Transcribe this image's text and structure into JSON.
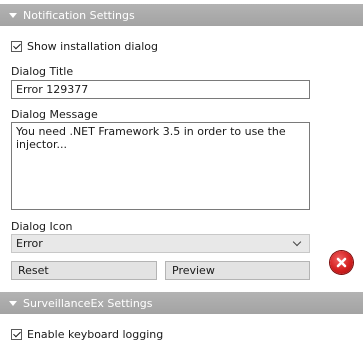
{
  "notification": {
    "header": "Notification Settings",
    "show_dialog_label": "Show installation dialog",
    "dialog_title_label": "Dialog Title",
    "dialog_title_value": "Error 129377",
    "dialog_message_label": "Dialog Message",
    "dialog_message_value": "You need .NET Framework 3.5 in order to use the injector...",
    "dialog_icon_label": "Dialog Icon",
    "dialog_icon_selected": "Error",
    "reset_label": "Reset",
    "preview_label": "Preview",
    "error_icon": "error-circle-x-icon"
  },
  "surveillance": {
    "header": "SurveillanceEx Settings",
    "keylog_label": "Enable keyboard logging"
  }
}
